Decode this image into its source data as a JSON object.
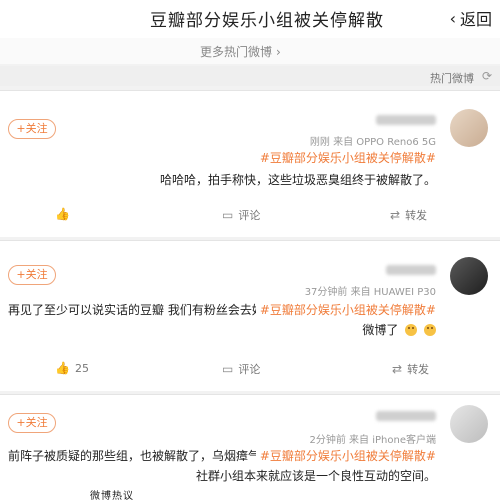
{
  "header": {
    "title": "豆瓣部分娱乐小组被关停解散",
    "back_label": "返回",
    "back_icon": "back-arrow-icon"
  },
  "more_link": {
    "label": "更多热门微博",
    "icon": "chevron-right-icon"
  },
  "section": {
    "label": "热门微博",
    "icon": "refresh-icon"
  },
  "posts": [
    {
      "meta": "刚刚 来自 OPPO Reno6 5G",
      "follow_label": "+关注",
      "topic": "#豆瓣部分娱乐小组被关停解散#",
      "content": "哈哈哈，拍手称快，这些垃圾恶臭组终于被解散了。",
      "actions": {
        "repost": "转发",
        "comment": "评论",
        "like": ""
      }
    },
    {
      "meta": "37分钟前 来自 HUAWEI P30",
      "follow_label": "+关注",
      "topic": "#豆瓣部分娱乐小组被关停解散#",
      "content": "再见了至少可以说实话的豆瓣 我们有粉丝会去好方位接着",
      "content2": "微博了",
      "actions": {
        "repost": "转发",
        "comment": "评论",
        "like": "25"
      }
    },
    {
      "meta": "2分钟前 来自 iPhone客户端",
      "follow_label": "+关注",
      "topic": "#豆瓣部分娱乐小组被关停解散#",
      "content": "前阵子被质疑的那些组，也被解散了，乌烟瘴气的小组整治一下挺好，",
      "content2": "社群小组本来就应该是一个良性互动的空间。",
      "actions": {}
    }
  ],
  "bottom_text": "微博热议"
}
